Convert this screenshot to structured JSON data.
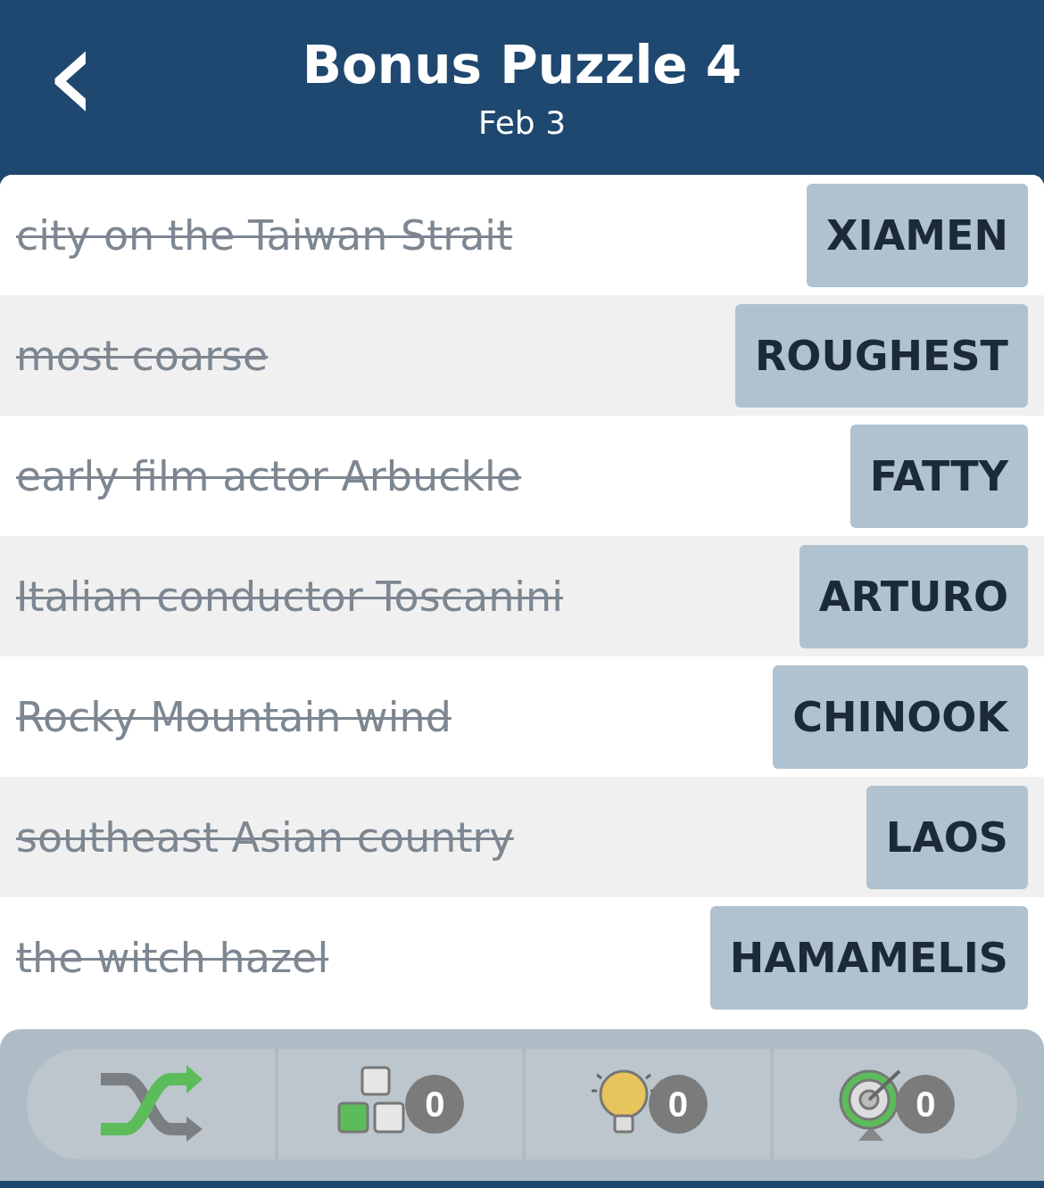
{
  "header": {
    "back": "‹",
    "title": "Bonus Puzzle 4",
    "subtitle": "Feb 3"
  },
  "clues": [
    {
      "clue": "city on the Taiwan Strait",
      "answer": "XIAMEN",
      "solved": true
    },
    {
      "clue": "most coarse",
      "answer": "ROUGHEST",
      "solved": true
    },
    {
      "clue": "early film actor Arbuckle",
      "answer": "FATTY",
      "solved": true
    },
    {
      "clue": "Italian conductor Toscanini",
      "answer": "ARTURO",
      "solved": true
    },
    {
      "clue": "Rocky Mountain wind",
      "answer": "CHINOOK",
      "solved": true
    },
    {
      "clue": "southeast Asian country",
      "answer": "LAOS",
      "solved": true
    },
    {
      "clue": "the witch hazel",
      "answer": "HAMAMELIS",
      "solved": true
    }
  ],
  "toolbar": [
    {
      "kind": "shuffle"
    },
    {
      "kind": "letters",
      "count": "0"
    },
    {
      "kind": "hint",
      "count": "0"
    },
    {
      "kind": "target",
      "count": "0"
    }
  ]
}
